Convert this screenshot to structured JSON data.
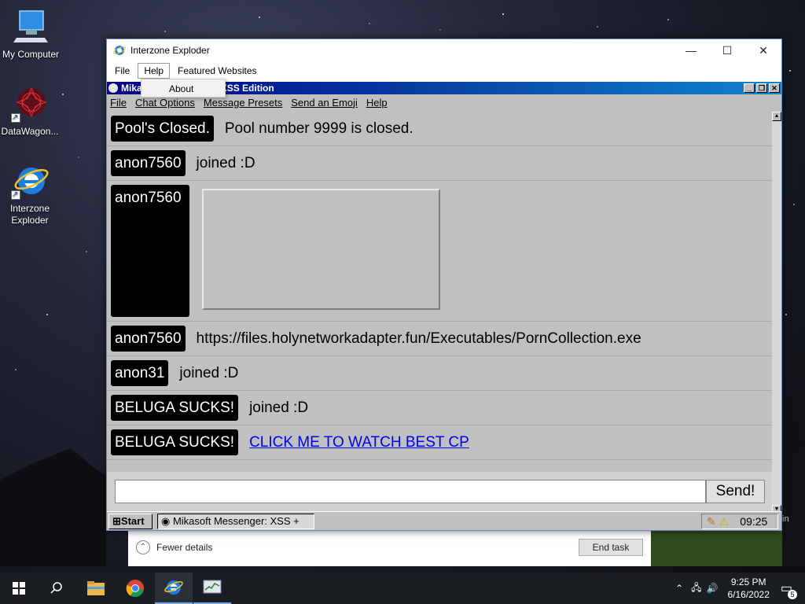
{
  "desktop": {
    "icons": [
      {
        "label": "My Computer",
        "icon": "computer-icon"
      },
      {
        "label": "DataWagon...",
        "icon": "datawagon-icon"
      },
      {
        "label": "Interzone Explorer",
        "label_lines": [
          "Interzone",
          "Exploder"
        ],
        "icon": "ie-icon"
      }
    ]
  },
  "browser": {
    "title": "Interzone Exploder",
    "menu": [
      "File",
      "Help",
      "Featured Websites"
    ],
    "active_menu": "Help",
    "dropdown": [
      "About"
    ]
  },
  "app": {
    "title": "Mikasoft Messenger: XSS Edition",
    "title_visible": "Mika",
    "title_visible_end": "XSS Edition",
    "menu": [
      "File",
      "Chat Options",
      "Message Presets",
      "Send an Emoji",
      "Help"
    ],
    "messages": [
      {
        "user": "Pool's Closed.",
        "text": "Pool number 9999 is closed.",
        "type": "text"
      },
      {
        "user": "anon7560",
        "text": "joined :D",
        "type": "text"
      },
      {
        "user": "anon7560",
        "text": "",
        "type": "image"
      },
      {
        "user": "anon7560",
        "text": "https://files.holynetworkadapter.fun/Executables/PornCollection.exe",
        "type": "text"
      },
      {
        "user": "anon31",
        "text": "joined :D",
        "type": "text"
      },
      {
        "user": "BELUGA SUCKS!",
        "text": "joined :D",
        "type": "text"
      },
      {
        "user": "BELUGA SUCKS!",
        "text": "CLICK ME TO WATCH BEST CP",
        "type": "link"
      }
    ],
    "input_value": "",
    "send_label": "Send!",
    "taskbar": {
      "start_label": "Start",
      "task_label": "Mikasoft Messenger: XSS +",
      "clock": "09:25"
    }
  },
  "task_manager": {
    "fewer_details": "Fewer details",
    "end_task": "End task"
  },
  "side_text": "in",
  "win_taskbar": {
    "time": "9:25 PM",
    "date": "6/16/2022",
    "notifications": "5",
    "pinned": [
      "start-icon",
      "search-icon",
      "file-explorer-icon",
      "chrome-icon",
      "interzone-explorer-icon",
      "task-manager-icon"
    ]
  },
  "colors": {
    "app_title_start": "#000080",
    "app_title_end": "#1084d0",
    "link": "#0000ee",
    "name_badge": "#000000"
  }
}
